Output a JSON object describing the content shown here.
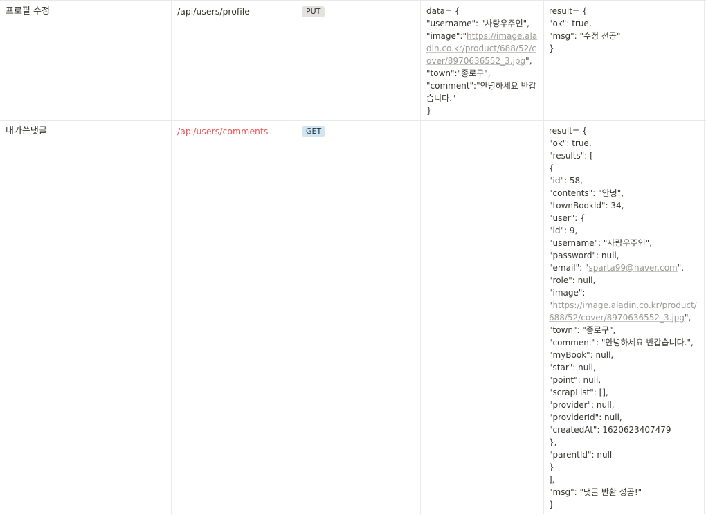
{
  "rows": [
    {
      "name": "프로필 수정",
      "endpoint": "/api/users/profile",
      "method": "PUT",
      "request_lines": [
        {
          "t": "data= {"
        },
        {
          "t": "\"username\": \"사랑우주인\","
        },
        {
          "pre": "\"image\":\"",
          "link": "https://image.aladin.co.kr/product/688/52/cover/8970636552_3.jpg",
          "post": "\","
        },
        {
          "t": "\"town\":\"종로구\","
        },
        {
          "t": "\"comment\":\"안녕하세요 반갑습니다.\""
        },
        {
          "t": "}"
        }
      ],
      "response_lines": [
        {
          "t": "result= {"
        },
        {
          "t": "\"ok\": true,"
        },
        {
          "t": "\"msg\": \"수정 선공\""
        },
        {
          "t": "}"
        }
      ]
    },
    {
      "name": "내가쓴댓글",
      "endpoint": "/api/users/comments",
      "method": "GET",
      "request_lines": [],
      "response_lines": [
        {
          "t": "result= {"
        },
        {
          "t": "\"ok\": true,"
        },
        {
          "t": "\"results\": ["
        },
        {
          "t": "{"
        },
        {
          "t": "\"id\": 58,"
        },
        {
          "t": "\"contents\": \"안녕\","
        },
        {
          "t": "\"townBookId\": 34,"
        },
        {
          "t": "\"user\": {"
        },
        {
          "t": "\"id\": 9,"
        },
        {
          "t": "\"username\": \"사랑우주인\","
        },
        {
          "t": "\"password\": null,"
        },
        {
          "pre": "\"email\": \"",
          "link": "sparta99@naver.com",
          "post": "\","
        },
        {
          "t": "\"role\": null,"
        },
        {
          "t": "\"image\":"
        },
        {
          "pre": "\"",
          "link": "https://image.aladin.co.kr/product/688/52/cover/8970636552_3.jpg",
          "post": "\","
        },
        {
          "t": "\"town\": \"종로구\","
        },
        {
          "t": "\"comment\": \"안녕하세요 반갑습니다.\","
        },
        {
          "t": "\"myBook\": null,"
        },
        {
          "t": "\"star\": null,"
        },
        {
          "t": "\"point\": null,"
        },
        {
          "t": "\"scrapList\": [],"
        },
        {
          "t": "\"provider\": null,"
        },
        {
          "t": "\"providerId\": null,"
        },
        {
          "t": "\"createdAt\": 1620623407479"
        },
        {
          "t": "},"
        },
        {
          "t": "\"parentId\": null"
        },
        {
          "t": "}"
        },
        {
          "t": "],"
        },
        {
          "t": "\"msg\": \"댓글 반환 성공!\""
        },
        {
          "t": "}"
        }
      ]
    }
  ]
}
